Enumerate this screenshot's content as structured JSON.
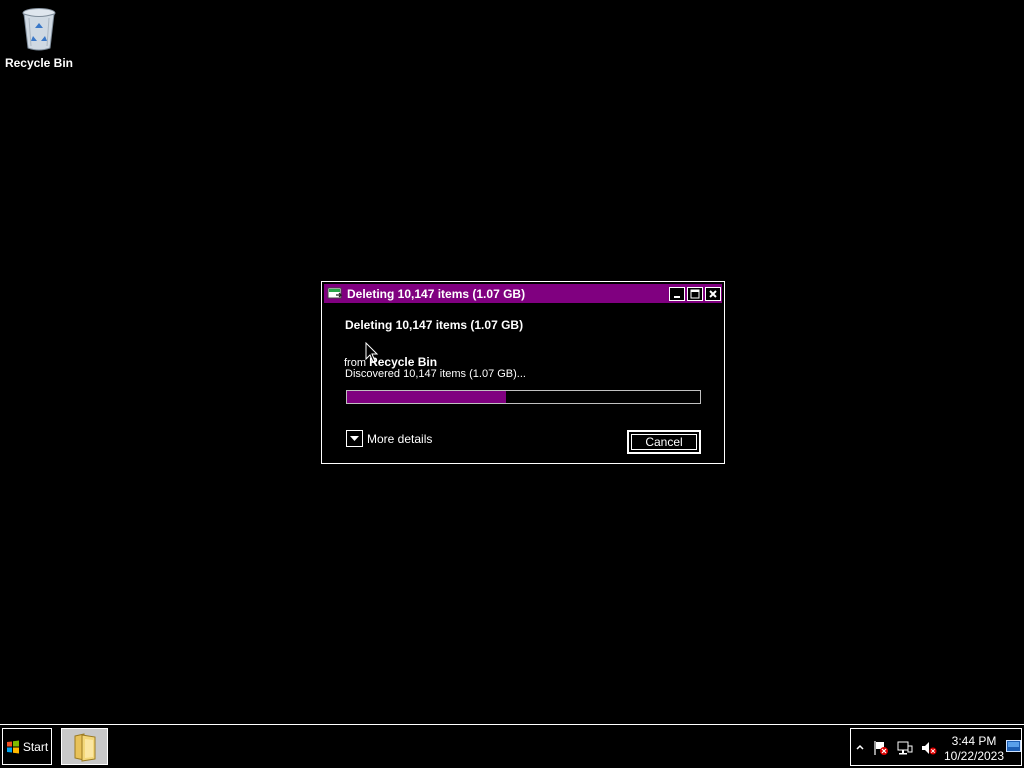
{
  "desktop": {
    "icons": [
      {
        "label": "Recycle Bin",
        "icon": "recycle-bin-icon"
      }
    ]
  },
  "dialog": {
    "title": "Deleting 10,147 items (1.07 GB)",
    "heading": "Deleting 10,147 items (1.07 GB)",
    "from_prefix": "from",
    "source": "Recycle Bin",
    "status": "Discovered 10,147 items (1.07 GB)...",
    "progress_percent": 45,
    "more_details_label": "More details",
    "cancel_label": "Cancel",
    "accent_color": "#800080"
  },
  "taskbar": {
    "start_label": "Start",
    "pinned": [
      {
        "icon": "folder-icon"
      }
    ],
    "tray": {
      "icons": [
        "show-hidden-icons-icon",
        "action-center-flag-icon",
        "network-icon",
        "volume-muted-icon"
      ],
      "time": "3:44 PM",
      "date": "10/22/2023"
    }
  }
}
